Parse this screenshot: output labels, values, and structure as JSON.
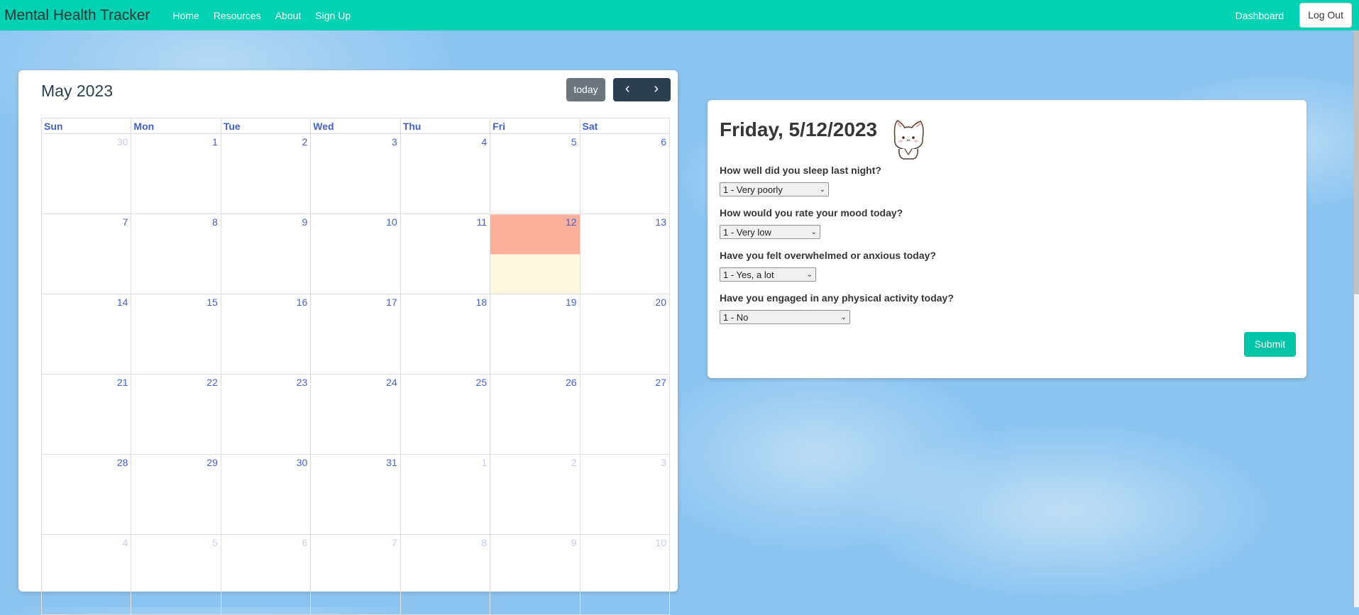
{
  "navbar": {
    "brand": "Mental Health Tracker",
    "links": [
      "Home",
      "Resources",
      "About",
      "Sign Up"
    ],
    "dashboard": "Dashboard",
    "logout": "Log Out",
    "color": "#00d1b2"
  },
  "calendar": {
    "title": "May 2023",
    "today_label": "today",
    "weekdays": [
      "Sun",
      "Mon",
      "Tue",
      "Wed",
      "Thu",
      "Fri",
      "Sat"
    ],
    "weeks": [
      [
        {
          "d": "30",
          "o": true
        },
        {
          "d": "1"
        },
        {
          "d": "2"
        },
        {
          "d": "3"
        },
        {
          "d": "4"
        },
        {
          "d": "5"
        },
        {
          "d": "6"
        }
      ],
      [
        {
          "d": "7"
        },
        {
          "d": "8"
        },
        {
          "d": "9"
        },
        {
          "d": "10"
        },
        {
          "d": "11"
        },
        {
          "d": "12",
          "today": true
        },
        {
          "d": "13"
        }
      ],
      [
        {
          "d": "14"
        },
        {
          "d": "15"
        },
        {
          "d": "16"
        },
        {
          "d": "17"
        },
        {
          "d": "18"
        },
        {
          "d": "19"
        },
        {
          "d": "20"
        }
      ],
      [
        {
          "d": "21"
        },
        {
          "d": "22"
        },
        {
          "d": "23"
        },
        {
          "d": "24"
        },
        {
          "d": "25"
        },
        {
          "d": "26"
        },
        {
          "d": "27"
        }
      ],
      [
        {
          "d": "28"
        },
        {
          "d": "29"
        },
        {
          "d": "30"
        },
        {
          "d": "31"
        },
        {
          "d": "1",
          "o": true
        },
        {
          "d": "2",
          "o": true
        },
        {
          "d": "3",
          "o": true
        }
      ],
      [
        {
          "d": "4",
          "o": true
        },
        {
          "d": "5",
          "o": true
        },
        {
          "d": "6",
          "o": true
        },
        {
          "d": "7",
          "o": true
        },
        {
          "d": "8",
          "o": true
        },
        {
          "d": "9",
          "o": true
        },
        {
          "d": "10",
          "o": true
        }
      ]
    ],
    "highlight_colors": {
      "today_top": "#fcaf9a",
      "today_bottom": "#fdf8de"
    }
  },
  "form": {
    "date": "Friday, 5/12/2023",
    "questions": [
      {
        "label": "How well did you sleep last night?",
        "value": "1 - Very poorly"
      },
      {
        "label": "How would you rate your mood today?",
        "value": "1 - Very low"
      },
      {
        "label": "Have you felt overwhelmed or anxious today?",
        "value": "1 - Yes, a lot"
      },
      {
        "label": "Have you engaged in any physical activity today?",
        "value": "1 - No"
      }
    ],
    "submit": "Submit"
  }
}
